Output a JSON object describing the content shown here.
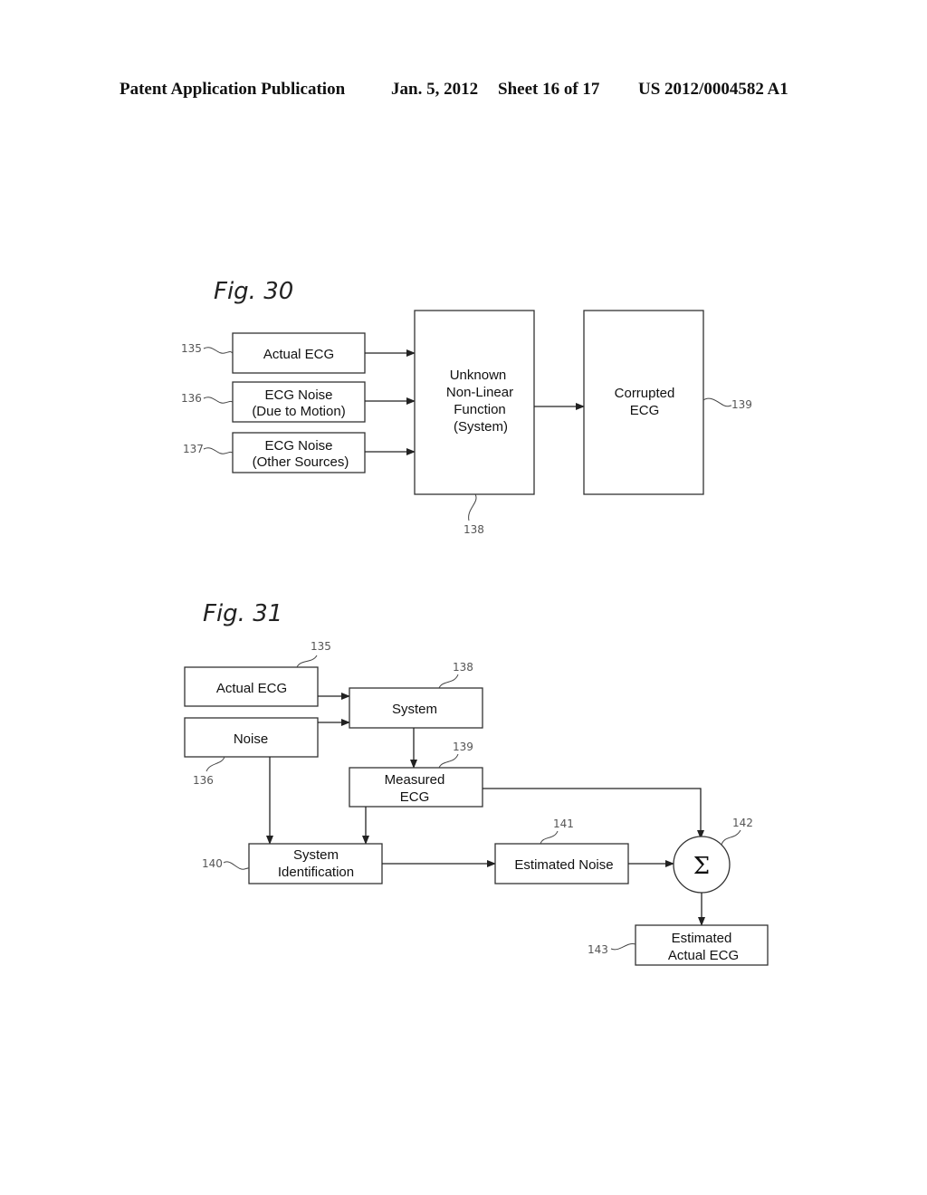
{
  "header": {
    "publication": "Patent Application Publication",
    "date": "Jan. 5, 2012",
    "sheet": "Sheet 16 of 17",
    "patent_number": "US 2012/0004582 A1"
  },
  "fig30": {
    "title": "Fig. 30",
    "blocks": {
      "actual_ecg": {
        "lines": [
          "Actual ECG"
        ],
        "ref": "135"
      },
      "noise_motion": {
        "lines": [
          "ECG Noise",
          "(Due to Motion)"
        ],
        "ref": "136"
      },
      "noise_other": {
        "lines": [
          "ECG Noise",
          "(Other Sources)"
        ],
        "ref": "137"
      },
      "system": {
        "lines": [
          "Unknown",
          "Non-Linear",
          "Function",
          "(System)"
        ],
        "ref": "138"
      },
      "corrupted": {
        "lines": [
          "Corrupted",
          "ECG"
        ],
        "ref": "139"
      }
    }
  },
  "fig31": {
    "title": "Fig. 31",
    "blocks": {
      "actual_ecg": {
        "lines": [
          "Actual ECG"
        ],
        "ref": "135"
      },
      "noise": {
        "lines": [
          "Noise"
        ],
        "ref": "136"
      },
      "system": {
        "lines": [
          "System"
        ],
        "ref": "138"
      },
      "measured": {
        "lines": [
          "Measured",
          "ECG"
        ],
        "ref": "139"
      },
      "sysid": {
        "lines": [
          "System",
          "Identification"
        ],
        "ref": "140"
      },
      "est_noise": {
        "lines": [
          "Estimated Noise"
        ],
        "ref": "141"
      },
      "sum": {
        "symbol": "Σ",
        "ref": "142"
      },
      "est_actual": {
        "lines": [
          "Estimated",
          "Actual ECG"
        ],
        "ref": "143"
      }
    }
  }
}
